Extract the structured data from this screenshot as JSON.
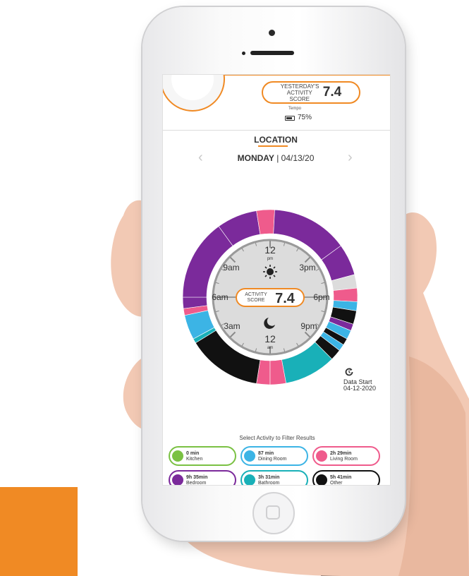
{
  "header": {
    "yesterday_label": "YESTERDAY'S ACTIVITY SCORE",
    "yesterday_score": "7.4",
    "tempo_label": "Tempo",
    "battery_pct": "75%",
    "battery_level": 0.75
  },
  "location": {
    "title": "LOCATION",
    "day": "MONDAY",
    "date_sep": " | ",
    "date": "04/13/20",
    "prev_icon": "chevron-left-icon",
    "next_icon": "chevron-right-icon"
  },
  "dial": {
    "hours": [
      "12",
      "3",
      "6",
      "9",
      "12",
      "9",
      "6",
      "3"
    ],
    "top_suffix": "pm",
    "bottom_suffix": "am",
    "label_12_top": "12",
    "label_pm": "pm",
    "label_12_bottom": "12",
    "label_am": "am",
    "label_3pm": "3pm",
    "label_6pm": "6pm",
    "label_9pm": "9pm",
    "label_3am": "3am",
    "label_6am": "6am",
    "label_9am": "9am",
    "score_label": "ACTIVITY SCORE",
    "score": "7.4",
    "sun_icon": "sun-icon",
    "moon_icon": "moon-icon"
  },
  "data_start": {
    "label": "Data Start",
    "date": "04-12-2020",
    "icon": "sync-icon"
  },
  "filter": {
    "title": "Select Activity to Filter Results",
    "chips": [
      {
        "duration": "0 min",
        "name": "Kitchen",
        "color": "#7ac143",
        "icon": "kitchen-icon"
      },
      {
        "duration": "87 min",
        "name": "Dining Room",
        "color": "#3cb4e5",
        "icon": "dining-room-icon"
      },
      {
        "duration": "2h 29min",
        "name": "Living Room",
        "color": "#ef5b8c",
        "icon": "living-room-icon"
      },
      {
        "duration": "9h 35min",
        "name": "Bedroom",
        "color": "#7b2a9b",
        "icon": "bedroom-icon"
      },
      {
        "duration": "3h 31min",
        "name": "Bathroom",
        "color": "#19b0b8",
        "icon": "bathroom-icon"
      },
      {
        "duration": "5h 41min",
        "name": "Other",
        "color": "#111111",
        "icon": "other-icon"
      }
    ]
  },
  "colors": {
    "accent": "#f08a24",
    "kitchen": "#7ac143",
    "dining": "#3cb4e5",
    "living": "#ef5b8c",
    "bedroom": "#7b2a9b",
    "bathroom": "#19b0b8",
    "other": "#111111"
  },
  "ring_segments_hours": [
    {
      "from": 0,
      "to": 0.6,
      "room": "living"
    },
    {
      "from": 0.6,
      "to": 3.9,
      "room": "other"
    },
    {
      "from": 3.9,
      "to": 4.1,
      "room": "bathroom"
    },
    {
      "from": 4.1,
      "to": 5.2,
      "room": "dining"
    },
    {
      "from": 5.2,
      "to": 5.5,
      "room": "living"
    },
    {
      "from": 5.5,
      "to": 6.0,
      "room": "bedroom"
    },
    {
      "from": 6.0,
      "to": 9.6,
      "room": "bedroom"
    },
    {
      "from": 9.6,
      "to": 11.4,
      "room": "bedroom"
    },
    {
      "from": 11.4,
      "to": 12.2,
      "room": "living"
    },
    {
      "from": 12.2,
      "to": 15.6,
      "room": "bedroom"
    },
    {
      "from": 15.6,
      "to": 17.0,
      "room": "bedroom"
    },
    {
      "from": 17.0,
      "to": 17.6,
      "room": "none"
    },
    {
      "from": 17.6,
      "to": 18.2,
      "room": "living"
    },
    {
      "from": 18.2,
      "to": 18.6,
      "room": "dining"
    },
    {
      "from": 18.6,
      "to": 19.2,
      "room": "other"
    },
    {
      "from": 19.2,
      "to": 19.5,
      "room": "bedroom"
    },
    {
      "from": 19.5,
      "to": 19.9,
      "room": "dining"
    },
    {
      "from": 19.9,
      "to": 20.2,
      "room": "other"
    },
    {
      "from": 20.2,
      "to": 20.5,
      "room": "dining"
    },
    {
      "from": 20.5,
      "to": 21.0,
      "room": "other"
    },
    {
      "from": 21.0,
      "to": 23.3,
      "room": "bathroom"
    },
    {
      "from": 23.3,
      "to": 24.0,
      "room": "living"
    }
  ]
}
